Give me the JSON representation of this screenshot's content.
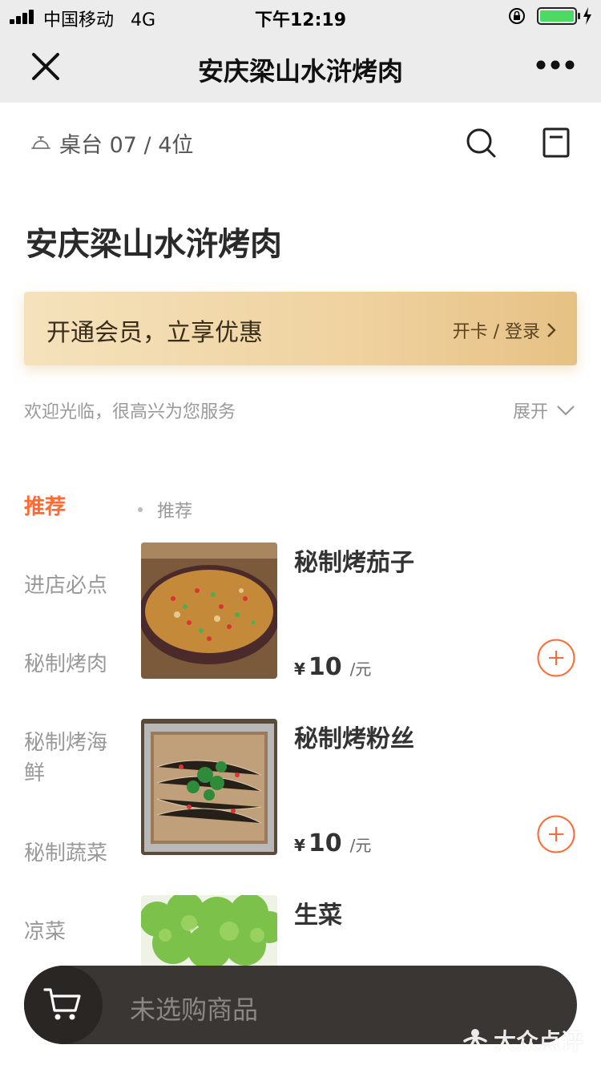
{
  "status_bar": {
    "carrier": "中国移动",
    "network": "4G",
    "time": "下午12:19"
  },
  "nav": {
    "title": "安庆梁山水浒烤肉",
    "close_icon": "close-icon",
    "more_icon": "more-icon"
  },
  "table": {
    "label": "桌台 07 / 4位"
  },
  "shop": {
    "name": "安庆梁山水浒烤肉"
  },
  "member": {
    "text": "开通会员，立享优惠",
    "link": "开卡 / 登录"
  },
  "welcome": {
    "text": "欢迎光临，很高兴为您服务",
    "expand": "展开"
  },
  "categories": [
    {
      "label": "推荐",
      "active": true
    },
    {
      "label": "进店必点"
    },
    {
      "label": "秘制烤肉"
    },
    {
      "label": "秘制烤海鲜"
    },
    {
      "label": "秘制蔬菜"
    },
    {
      "label": "凉菜"
    }
  ],
  "section": {
    "title": "推荐"
  },
  "products": [
    {
      "name": "秘制烤茄子",
      "currency": "¥",
      "price": "10",
      "unit": "/元"
    },
    {
      "name": "秘制烤粉丝",
      "currency": "¥",
      "price": "10",
      "unit": "/元"
    },
    {
      "name": "生菜"
    }
  ],
  "cart": {
    "text": "未选购商品"
  },
  "watermark": {
    "text": "大众点评"
  },
  "colors": {
    "accent": "#ff6a33",
    "banner_gold": "#efd29f",
    "cart_bg": "#3a3633"
  }
}
